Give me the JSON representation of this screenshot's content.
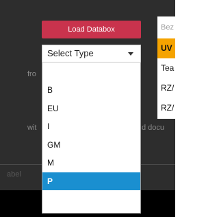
{
  "toolbar": {
    "load_label": "Load Databox"
  },
  "select": {
    "value": "Select Type",
    "options": [
      "",
      "B",
      "EU",
      "I",
      "GM",
      "M",
      "P"
    ],
    "selected": "P"
  },
  "background_text": {
    "from": "fro",
    "with": "wit",
    "docu": "d docu",
    "label": "abel"
  },
  "side_list": {
    "header": "Bez",
    "rows": [
      "UV",
      "Tea",
      "RZ/",
      "RZ/"
    ]
  },
  "colors": {
    "panel": "#2d2d2d",
    "button": "#c9334d",
    "selected_option": "#1a8fd0",
    "active_row": "#f5a300"
  }
}
